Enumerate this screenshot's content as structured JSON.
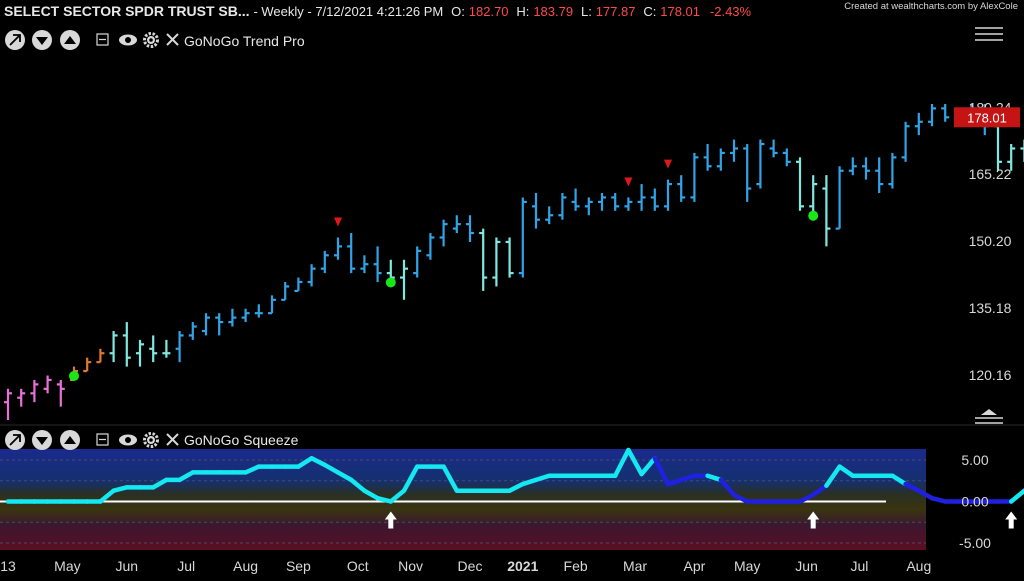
{
  "header": {
    "symbol": "SELECT SECTOR SPDR TRUST SB...",
    "period": " - Weekly - 7/12/2021 4:21:26 PM",
    "o_label": "O:",
    "o_value": "182.70",
    "h_label": "H:",
    "h_value": "183.79",
    "l_label": "L:",
    "l_value": "177.87",
    "c_label": "C:",
    "c_value": "178.01",
    "change": "-2.43%",
    "credit": "Created at wealthcharts.com by AlexCole"
  },
  "panels": {
    "price": {
      "indicator": "GoNoGo Trend Pro"
    },
    "squeeze": {
      "indicator": "GoNoGo Squeeze"
    }
  },
  "colors": {
    "background": "#000000",
    "go_strong": "#2fa4e7",
    "go_weak": "#7fe8e0",
    "nogo_weak": "#e0782a",
    "nogo_strong": "#e870d8",
    "reversal_up": "#19e619",
    "reversal_down": "#e01818",
    "squeeze_line": "#14e8f0",
    "squeeze_building": "#2020e0",
    "price_badge": "#c41414"
  },
  "chart_data": [
    {
      "type": "bar",
      "series_kind": "ohlc",
      "ylim": [
        110,
        192
      ],
      "y_ticks": [
        120.16,
        135.18,
        150.2,
        165.22,
        180.24
      ],
      "y_tick_labels": [
        "120.16",
        "135.18",
        "150.20",
        "165.22",
        "180.24"
      ],
      "last_price": 178.01,
      "last_price_label": "178.01",
      "x_tick_labels": [
        "13",
        "May",
        "Jun",
        "Jul",
        "Aug",
        "Sep",
        "Oct",
        "Nov",
        "Dec",
        "2021",
        "Feb",
        "Mar",
        "Apr",
        "May",
        "Jun",
        "Jul",
        "Aug"
      ],
      "x_tick_weeks": [
        0,
        4.5,
        9,
        13.5,
        18,
        22,
        26.5,
        30.5,
        35,
        39,
        43,
        47.5,
        52,
        56,
        60.5,
        64.5,
        69
      ],
      "bars": [
        {
          "o": 114,
          "h": 117,
          "l": 110,
          "c": 116,
          "color": "nogo_strong"
        },
        {
          "o": 115,
          "h": 117,
          "l": 113,
          "c": 116,
          "color": "nogo_strong"
        },
        {
          "o": 116,
          "h": 119,
          "l": 114,
          "c": 118,
          "color": "nogo_strong"
        },
        {
          "o": 117,
          "h": 120,
          "l": 116,
          "c": 119,
          "color": "nogo_strong"
        },
        {
          "o": 118,
          "h": 119,
          "l": 113,
          "c": 117,
          "color": "nogo_strong"
        },
        {
          "o": 119,
          "h": 122,
          "l": 119,
          "c": 121,
          "color": "nogo_weak"
        },
        {
          "o": 121,
          "h": 124,
          "l": 121,
          "c": 123,
          "color": "nogo_weak"
        },
        {
          "o": 123,
          "h": 126,
          "l": 123,
          "c": 125,
          "color": "nogo_weak"
        },
        {
          "o": 125,
          "h": 130,
          "l": 123,
          "c": 129,
          "color": "go_weak"
        },
        {
          "o": 129,
          "h": 132,
          "l": 122,
          "c": 124,
          "color": "go_weak"
        },
        {
          "o": 125,
          "h": 128,
          "l": 122,
          "c": 127,
          "color": "go_weak"
        },
        {
          "o": 126,
          "h": 129,
          "l": 123,
          "c": 125,
          "color": "go_weak"
        },
        {
          "o": 125,
          "h": 128,
          "l": 124,
          "c": 125,
          "color": "go_weak"
        },
        {
          "o": 126,
          "h": 130,
          "l": 123,
          "c": 129,
          "color": "go_strong"
        },
        {
          "o": 129,
          "h": 132,
          "l": 128,
          "c": 131,
          "color": "go_strong"
        },
        {
          "o": 130,
          "h": 134,
          "l": 129,
          "c": 133,
          "color": "go_strong"
        },
        {
          "o": 133,
          "h": 134,
          "l": 129,
          "c": 132,
          "color": "go_strong"
        },
        {
          "o": 132,
          "h": 135,
          "l": 131,
          "c": 133,
          "color": "go_strong"
        },
        {
          "o": 133,
          "h": 135,
          "l": 132,
          "c": 134,
          "color": "go_strong"
        },
        {
          "o": 134,
          "h": 136,
          "l": 133,
          "c": 134,
          "color": "go_strong"
        },
        {
          "o": 134,
          "h": 138,
          "l": 134,
          "c": 137,
          "color": "go_strong"
        },
        {
          "o": 137,
          "h": 141,
          "l": 137,
          "c": 140,
          "color": "go_strong"
        },
        {
          "o": 139,
          "h": 142,
          "l": 139,
          "c": 141,
          "color": "go_strong"
        },
        {
          "o": 141,
          "h": 145,
          "l": 140,
          "c": 144,
          "color": "go_strong"
        },
        {
          "o": 144,
          "h": 148,
          "l": 143,
          "c": 147,
          "color": "go_strong"
        },
        {
          "o": 147,
          "h": 151,
          "l": 146,
          "c": 149,
          "color": "go_strong"
        },
        {
          "o": 149,
          "h": 152,
          "l": 143,
          "c": 144,
          "color": "go_strong"
        },
        {
          "o": 144,
          "h": 147,
          "l": 143,
          "c": 145,
          "color": "go_strong"
        },
        {
          "o": 145,
          "h": 149,
          "l": 141,
          "c": 143,
          "color": "go_strong"
        },
        {
          "o": 143,
          "h": 146,
          "l": 140,
          "c": 142,
          "color": "go_weak"
        },
        {
          "o": 142,
          "h": 146,
          "l": 137,
          "c": 144,
          "color": "go_weak"
        },
        {
          "o": 143,
          "h": 149,
          "l": 142,
          "c": 148,
          "color": "go_strong"
        },
        {
          "o": 147,
          "h": 152,
          "l": 146,
          "c": 151,
          "color": "go_strong"
        },
        {
          "o": 151,
          "h": 155,
          "l": 149,
          "c": 154,
          "color": "go_strong"
        },
        {
          "o": 153,
          "h": 156,
          "l": 152,
          "c": 154,
          "color": "go_strong"
        },
        {
          "o": 154,
          "h": 156,
          "l": 150,
          "c": 152,
          "color": "go_strong"
        },
        {
          "o": 152,
          "h": 153,
          "l": 139,
          "c": 142,
          "color": "go_weak"
        },
        {
          "o": 142,
          "h": 151,
          "l": 140,
          "c": 150,
          "color": "go_weak"
        },
        {
          "o": 150,
          "h": 151,
          "l": 142,
          "c": 143,
          "color": "go_weak"
        },
        {
          "o": 143,
          "h": 160,
          "l": 142,
          "c": 159,
          "color": "go_strong"
        },
        {
          "o": 158,
          "h": 161,
          "l": 153,
          "c": 155,
          "color": "go_strong"
        },
        {
          "o": 155,
          "h": 158,
          "l": 154,
          "c": 156,
          "color": "go_strong"
        },
        {
          "o": 156,
          "h": 161,
          "l": 155,
          "c": 160,
          "color": "go_strong"
        },
        {
          "o": 159,
          "h": 162,
          "l": 157,
          "c": 158,
          "color": "go_strong"
        },
        {
          "o": 158,
          "h": 160,
          "l": 156,
          "c": 159,
          "color": "go_strong"
        },
        {
          "o": 159,
          "h": 161,
          "l": 157,
          "c": 160,
          "color": "go_strong"
        },
        {
          "o": 160,
          "h": 161,
          "l": 157,
          "c": 158,
          "color": "go_strong"
        },
        {
          "o": 158,
          "h": 160,
          "l": 157,
          "c": 159,
          "color": "go_strong"
        },
        {
          "o": 159,
          "h": 163,
          "l": 157,
          "c": 160,
          "color": "go_strong"
        },
        {
          "o": 160,
          "h": 162,
          "l": 157,
          "c": 158,
          "color": "go_strong"
        },
        {
          "o": 158,
          "h": 164,
          "l": 157,
          "c": 163,
          "color": "go_strong"
        },
        {
          "o": 163,
          "h": 165,
          "l": 159,
          "c": 160,
          "color": "go_strong"
        },
        {
          "o": 160,
          "h": 170,
          "l": 159,
          "c": 169,
          "color": "go_strong"
        },
        {
          "o": 169,
          "h": 172,
          "l": 166,
          "c": 167,
          "color": "go_strong"
        },
        {
          "o": 167,
          "h": 171,
          "l": 166,
          "c": 170,
          "color": "go_strong"
        },
        {
          "o": 170,
          "h": 173,
          "l": 168,
          "c": 171,
          "color": "go_strong"
        },
        {
          "o": 171,
          "h": 172,
          "l": 159,
          "c": 162,
          "color": "go_strong"
        },
        {
          "o": 163,
          "h": 173,
          "l": 162,
          "c": 172,
          "color": "go_strong"
        },
        {
          "o": 171,
          "h": 173,
          "l": 169,
          "c": 170,
          "color": "go_strong"
        },
        {
          "o": 170,
          "h": 171,
          "l": 167,
          "c": 168,
          "color": "go_strong"
        },
        {
          "o": 168,
          "h": 169,
          "l": 157,
          "c": 158,
          "color": "go_weak"
        },
        {
          "o": 158,
          "h": 165,
          "l": 155,
          "c": 163,
          "color": "go_weak"
        },
        {
          "o": 162,
          "h": 165,
          "l": 149,
          "c": 153,
          "color": "go_weak"
        },
        {
          "o": 153,
          "h": 167,
          "l": 153,
          "c": 166,
          "color": "go_strong"
        },
        {
          "o": 166,
          "h": 169,
          "l": 165,
          "c": 167,
          "color": "go_strong"
        },
        {
          "o": 167,
          "h": 169,
          "l": 164,
          "c": 166,
          "color": "go_strong"
        },
        {
          "o": 166,
          "h": 169,
          "l": 161,
          "c": 163,
          "color": "go_strong"
        },
        {
          "o": 163,
          "h": 170,
          "l": 162,
          "c": 169,
          "color": "go_strong"
        },
        {
          "o": 169,
          "h": 177,
          "l": 168,
          "c": 176,
          "color": "go_strong"
        },
        {
          "o": 176,
          "h": 179,
          "l": 174,
          "c": 177,
          "color": "go_strong"
        },
        {
          "o": 177,
          "h": 181,
          "l": 176,
          "c": 180,
          "color": "go_strong"
        },
        {
          "o": 180,
          "h": 181,
          "l": 177,
          "c": 178,
          "color": "go_strong"
        },
        {
          "o": 178,
          "h": 180,
          "l": 176,
          "c": 179,
          "color": "go_strong"
        },
        {
          "o": 179,
          "h": 181,
          "l": 178,
          "c": 180,
          "color": "go_strong"
        },
        {
          "o": 180,
          "h": 181,
          "l": 174,
          "c": 176,
          "color": "go_strong"
        },
        {
          "o": 176,
          "h": 178,
          "l": 166,
          "c": 168,
          "color": "go_weak"
        },
        {
          "o": 168,
          "h": 172,
          "l": 166,
          "c": 171,
          "color": "go_weak"
        },
        {
          "o": 171,
          "h": 173,
          "l": 168,
          "c": 169,
          "color": "go_weak"
        },
        {
          "o": 169,
          "h": 175,
          "l": 168,
          "c": 174,
          "color": "go_weak"
        },
        {
          "o": 174,
          "h": 175,
          "l": 170,
          "c": 171,
          "color": "go_weak"
        },
        {
          "o": 171,
          "h": 173,
          "l": 170,
          "c": 172,
          "color": "go_weak"
        },
        {
          "o": 172,
          "h": 174,
          "l": 170,
          "c": 171,
          "color": "go_weak"
        },
        {
          "o": 171,
          "h": 175,
          "l": 170,
          "c": 174,
          "color": "go_weak"
        },
        {
          "o": 173,
          "h": 175,
          "l": 171,
          "c": 172,
          "color": "go_weak"
        },
        {
          "o": 172,
          "h": 179,
          "l": 172,
          "c": 178,
          "color": "go_strong"
        },
        {
          "o": 178,
          "h": 183,
          "l": 177,
          "c": 182,
          "color": "go_strong"
        },
        {
          "o": 182,
          "h": 184,
          "l": 180,
          "c": 183,
          "color": "go_strong"
        },
        {
          "o": 182.7,
          "h": 183.79,
          "l": 177.87,
          "c": 178.01,
          "color": "go_strong"
        }
      ],
      "reversal_up_markers": [
        5,
        29,
        61,
        81
      ],
      "reversal_down_markers": [
        25,
        47,
        50
      ]
    },
    {
      "type": "line",
      "ylim": [
        -6.2,
        6.8
      ],
      "y_ticks": [
        5,
        0,
        -5
      ],
      "y_tick_labels": [
        "5.00",
        "0.00",
        "-5.00"
      ],
      "zero_line": 0,
      "values": [
        0,
        0,
        0,
        0,
        0,
        0,
        0,
        0,
        1.3,
        1.7,
        1.7,
        1.7,
        2.6,
        2.6,
        3.5,
        3.5,
        3.5,
        3.5,
        3.5,
        4.2,
        4.2,
        4.2,
        4.2,
        5.2,
        4.4,
        3.5,
        2.6,
        1.3,
        0.4,
        0,
        1.3,
        4.2,
        4.2,
        4.2,
        1.3,
        1.3,
        1.3,
        1.3,
        1.3,
        2.1,
        2.6,
        3.1,
        3.1,
        3.1,
        3.1,
        3.1,
        3.1,
        6.2,
        3.3,
        5.2,
        2.1,
        2.6,
        3.1,
        3.1,
        2.6,
        0.8,
        0,
        0,
        0,
        0,
        0,
        0.8,
        1.9,
        4.2,
        3.1,
        3.1,
        3.1,
        3.1,
        2.1,
        1.3,
        0.4,
        0,
        0,
        0,
        0,
        0,
        0,
        1.3,
        2.1,
        3.1,
        2.1
      ],
      "building_segments": [
        [
          49,
          53
        ],
        [
          54,
          62
        ],
        [
          68,
          76
        ]
      ],
      "arrow_markers": [
        29,
        61,
        76
      ]
    }
  ]
}
